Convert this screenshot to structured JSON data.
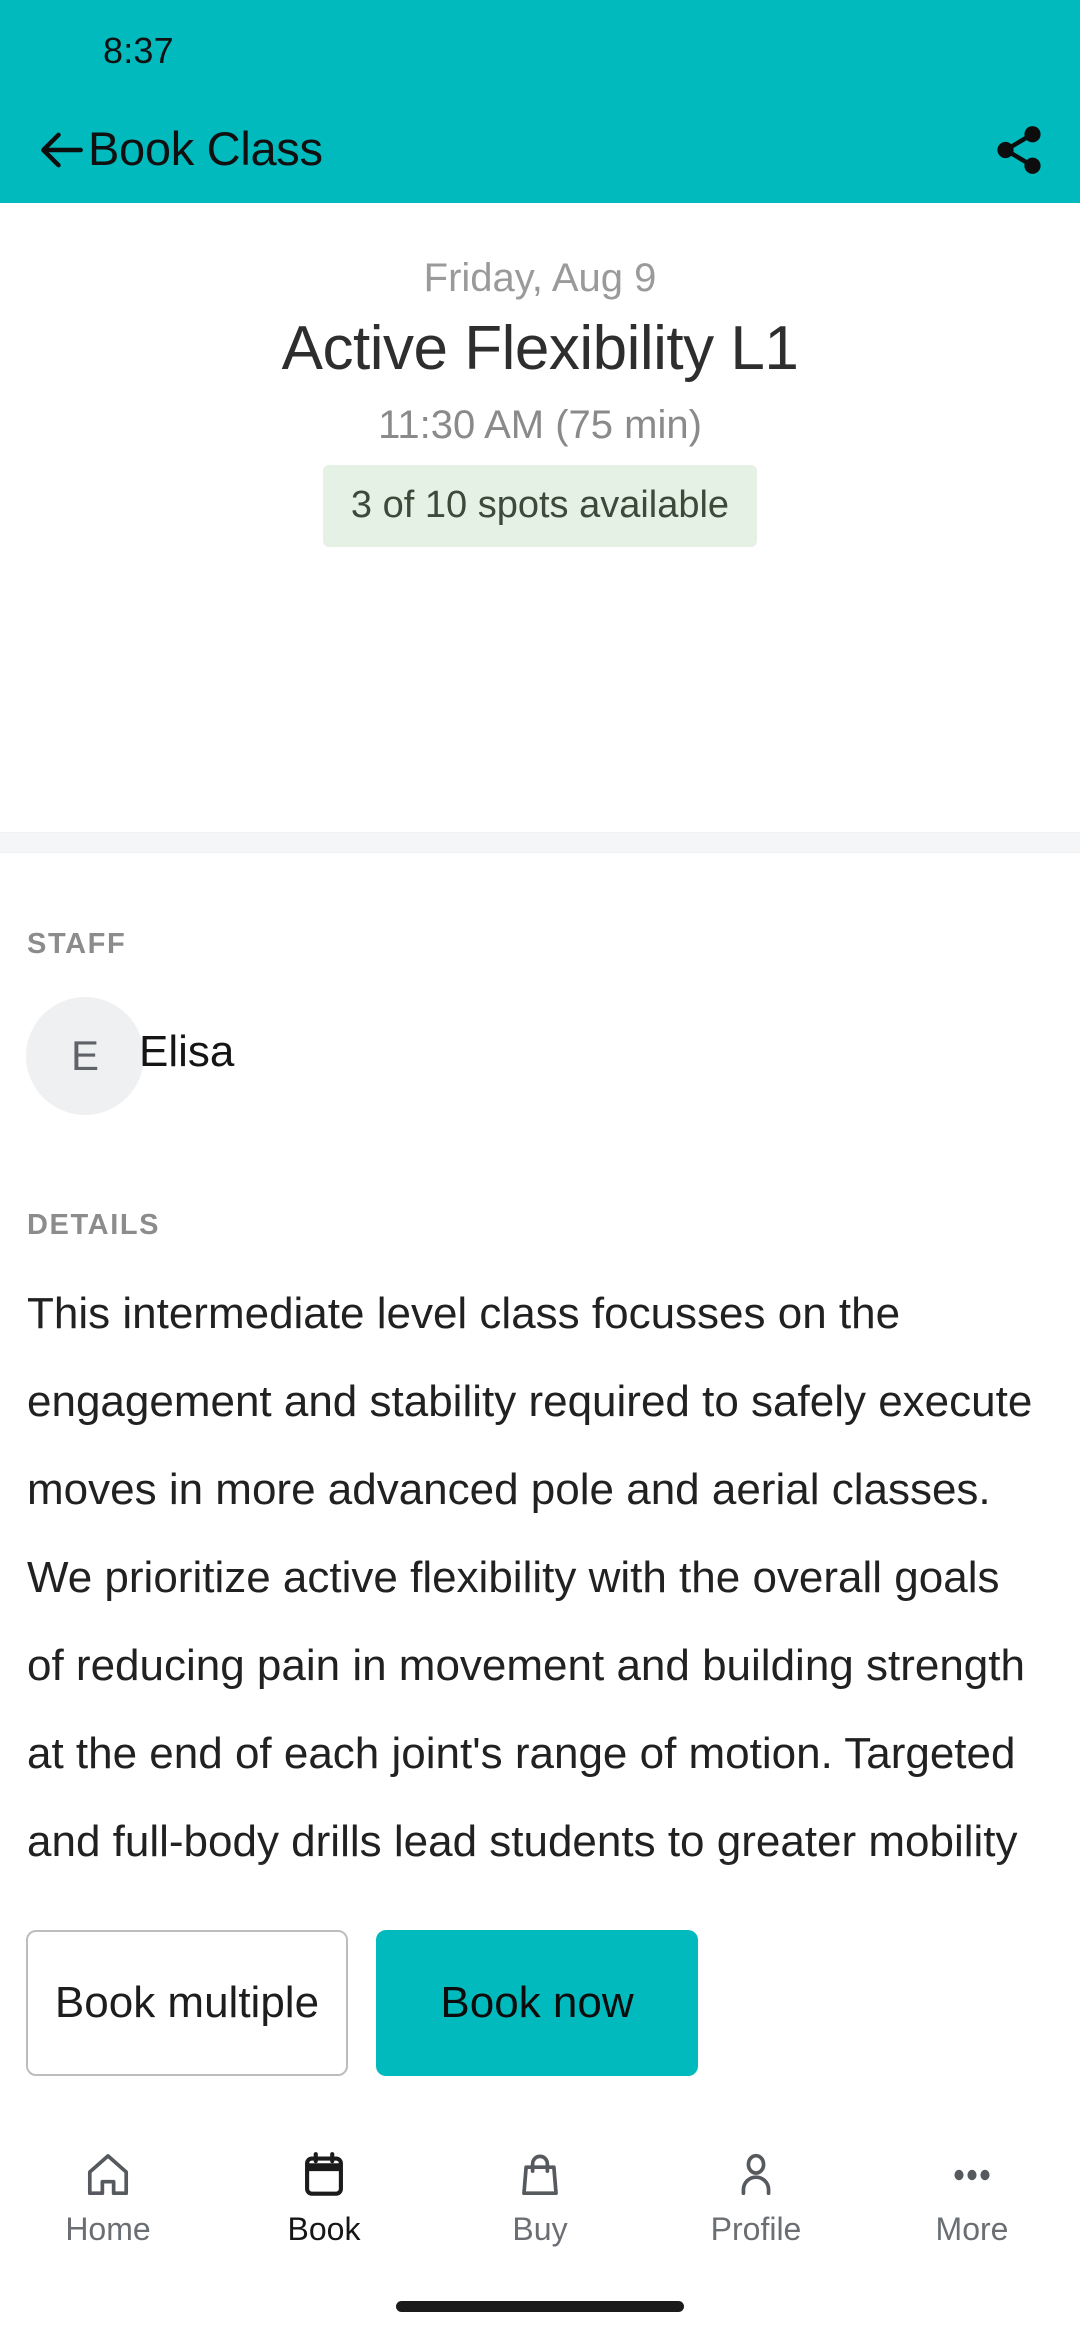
{
  "status_bar": {
    "time": "8:37"
  },
  "app_bar": {
    "title": "Book Class",
    "back_icon": "arrow-left-icon",
    "share_icon": "share-icon"
  },
  "class_summary": {
    "date": "Friday, Aug 9",
    "title": "Active Flexibility L1",
    "time": "11:30 AM (75 min)",
    "spots": "3 of 10 spots available"
  },
  "staff": {
    "section_label": "STAFF",
    "avatar_initial": "E",
    "name": "Elisa"
  },
  "details": {
    "section_label": "DETAILS",
    "body": "This intermediate level class focusses on the engagement and stability required to safely execute moves in more advanced pole and aerial classes.    We prioritize active flexibility with the overall goals of reducing pain in movement and building strength at the end of each joint's range of motion. Targeted and full-body drills lead students to greater mobility and engagement of key areas like:"
  },
  "actions": {
    "secondary_label": "Book multiple",
    "primary_label": "Book now"
  },
  "bottom_nav": {
    "items": [
      {
        "label": "Home",
        "icon": "home-icon",
        "active": false
      },
      {
        "label": "Book",
        "icon": "calendar-icon",
        "active": true
      },
      {
        "label": "Buy",
        "icon": "shopping-bag-icon",
        "active": false
      },
      {
        "label": "Profile",
        "icon": "person-icon",
        "active": false
      },
      {
        "label": "More",
        "icon": "more-horizontal-icon",
        "active": false
      }
    ]
  },
  "colors": {
    "brand_teal": "#00babe",
    "badge_background": "#e5f1e4",
    "badge_text": "#3c4a3a",
    "avatar_background": "#eef0f2",
    "section_divider": "#f5f6f8"
  }
}
